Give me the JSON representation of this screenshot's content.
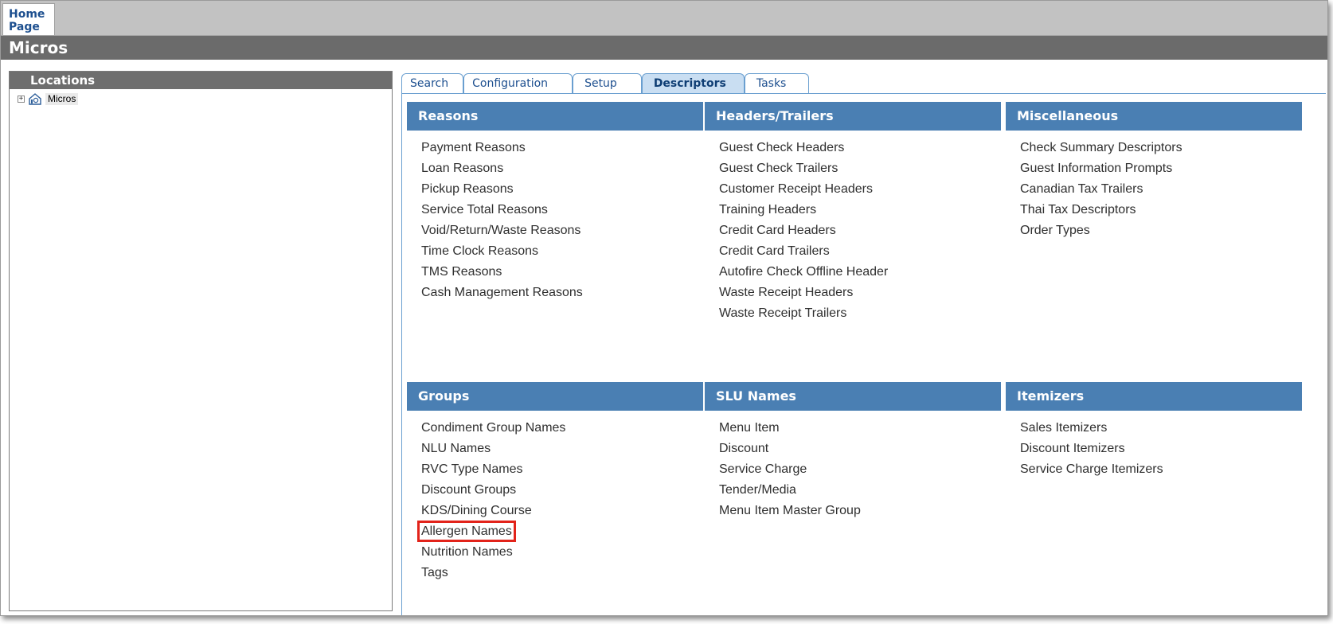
{
  "home_tab": {
    "label_line1": "Home",
    "label_line2": "Page"
  },
  "title": "Micros",
  "locations": {
    "header": "Locations",
    "tree": [
      {
        "label": "Micros",
        "expander": "+"
      }
    ]
  },
  "tabs": [
    {
      "label": "Search"
    },
    {
      "label": "Configuration"
    },
    {
      "label": "Setup"
    },
    {
      "label": "Descriptors",
      "active": true
    },
    {
      "label": "Tasks"
    }
  ],
  "sections": {
    "reasons": {
      "title": "Reasons",
      "links": [
        "Payment Reasons",
        "Loan Reasons",
        "Pickup Reasons",
        "Service Total Reasons",
        "Void/Return/Waste Reasons",
        "Time Clock Reasons",
        "TMS Reasons",
        "Cash Management Reasons"
      ]
    },
    "headers_trailers": {
      "title": "Headers/Trailers",
      "links": [
        "Guest Check Headers",
        "Guest Check Trailers",
        "Customer Receipt Headers",
        "Training Headers",
        "Credit Card Headers",
        "Credit Card Trailers",
        "Autofire Check Offline Header",
        "Waste Receipt Headers",
        "Waste Receipt Trailers"
      ]
    },
    "miscellaneous": {
      "title": "Miscellaneous",
      "links": [
        "Check Summary Descriptors",
        "Guest Information Prompts",
        "Canadian Tax Trailers",
        "Thai Tax Descriptors",
        "Order Types"
      ]
    },
    "groups": {
      "title": "Groups",
      "links": [
        "Condiment Group Names",
        "NLU Names",
        "RVC Type Names",
        "Discount Groups",
        "KDS/Dining Course",
        "Allergen Names",
        "Nutrition Names",
        "Tags"
      ],
      "highlighted_link": "Allergen Names"
    },
    "slu_names": {
      "title": "SLU Names",
      "links": [
        "Menu Item",
        "Discount",
        "Service Charge",
        "Tender/Media",
        "Menu Item Master Group"
      ]
    },
    "itemizers": {
      "title": "Itemizers",
      "links": [
        "Sales Itemizers",
        "Discount Itemizers",
        "Service Charge Itemizers"
      ]
    }
  },
  "colors": {
    "section_header": "#4a7fb3",
    "active_tab": "#c9def2",
    "title_bar": "#6b6b6b",
    "highlight": "#e2231a"
  }
}
